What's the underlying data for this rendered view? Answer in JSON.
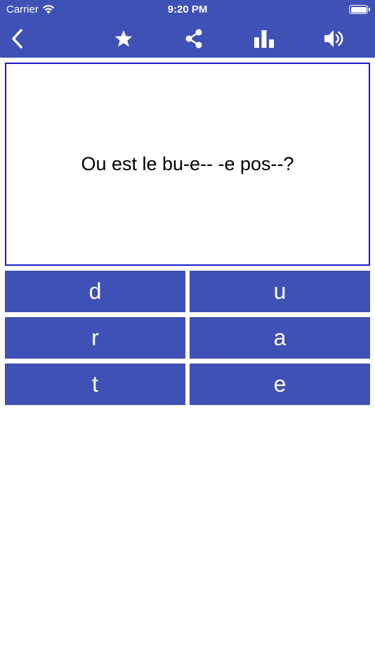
{
  "status_bar": {
    "carrier": "Carrier",
    "time": "9:20 PM"
  },
  "toolbar": {
    "icons": [
      "chevron-left-icon",
      "star-icon",
      "share-icon",
      "bar-chart-icon",
      "speaker-icon"
    ]
  },
  "colors": {
    "primary": "#3f51b5",
    "card_border": "#1a1ac8",
    "background": "#ffffff"
  },
  "quiz": {
    "question": "Ou est le bu-e-- -e pos--?",
    "answers": [
      "d",
      "u",
      "r",
      "a",
      "t",
      "e"
    ]
  }
}
